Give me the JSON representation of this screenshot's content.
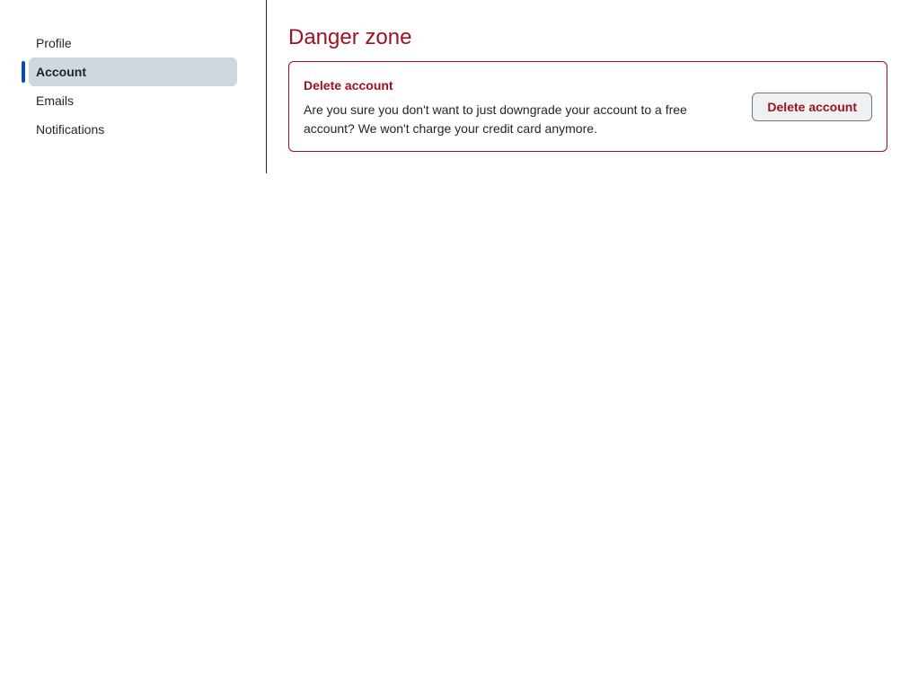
{
  "sidebar": {
    "items": [
      {
        "label": "Profile",
        "active": false
      },
      {
        "label": "Account",
        "active": true
      },
      {
        "label": "Emails",
        "active": false
      },
      {
        "label": "Notifications",
        "active": false
      }
    ]
  },
  "main": {
    "title": "Danger zone",
    "danger_zone": {
      "heading": "Delete account",
      "description": "Are you sure you don't want to just downgrade your account to a free account? We won't charge your credit card anymore.",
      "button_label": "Delete account"
    }
  },
  "colors": {
    "danger": "#a0111f",
    "accent": "#0b4bb8",
    "active_bg": "#d0d7de"
  }
}
